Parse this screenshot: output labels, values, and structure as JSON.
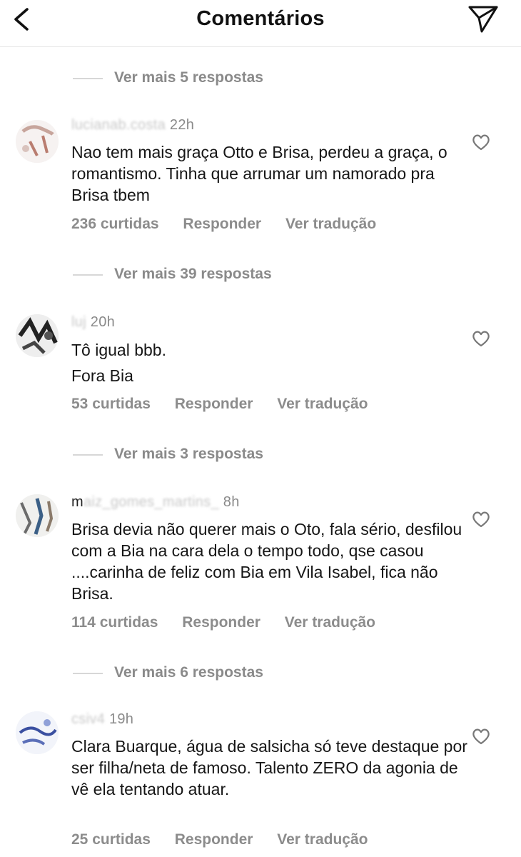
{
  "header": {
    "title": "Comentários",
    "back_icon": "chevron-left-icon",
    "send_icon": "paper-plane-icon"
  },
  "threads": [
    {
      "more_replies": "Ver mais 5 respostas"
    },
    {
      "username_visible": "lucianab.costa",
      "time": "22h",
      "text": "Nao tem mais graça Otto e Brisa, perdeu a graça, o romantismo. Tinha que arrumar um namorado pra Brisa tbem",
      "likes": "236 curtidas",
      "reply": "Responder",
      "translate": "Ver tradução",
      "more_replies": "Ver mais 39 respostas"
    },
    {
      "username_visible": "luj",
      "time": "20h",
      "text_lines": [
        "Tô igual bbb.",
        "Fora Bia"
      ],
      "likes": "53 curtidas",
      "reply": "Responder",
      "translate": "Ver tradução",
      "more_replies": "Ver mais 3 respostas"
    },
    {
      "username_visible": "m",
      "time": "8h",
      "text": "Brisa devia não querer mais o Oto, fala sério, desfilou com a Bia na cara dela o tempo todo, qse casou ....carinha de feliz com Bia em Vila Isabel, fica não Brisa.",
      "likes": "114 curtidas",
      "reply": "Responder",
      "translate": "Ver tradução",
      "more_replies": "Ver mais 6 respostas"
    },
    {
      "username_visible": "csiv4",
      "time": "19h",
      "text": "Clara Buarque, água de salsicha só teve destaque por ser filha/neta de famoso. Talento ZERO da agonia de vê ela tentando atuar.",
      "likes": "25 curtidas",
      "reply": "Responder",
      "translate": "Ver tradução"
    }
  ],
  "colors": {
    "text": "#161616",
    "secondary": "#8c8c8c",
    "divider": "#d7d7d7"
  }
}
